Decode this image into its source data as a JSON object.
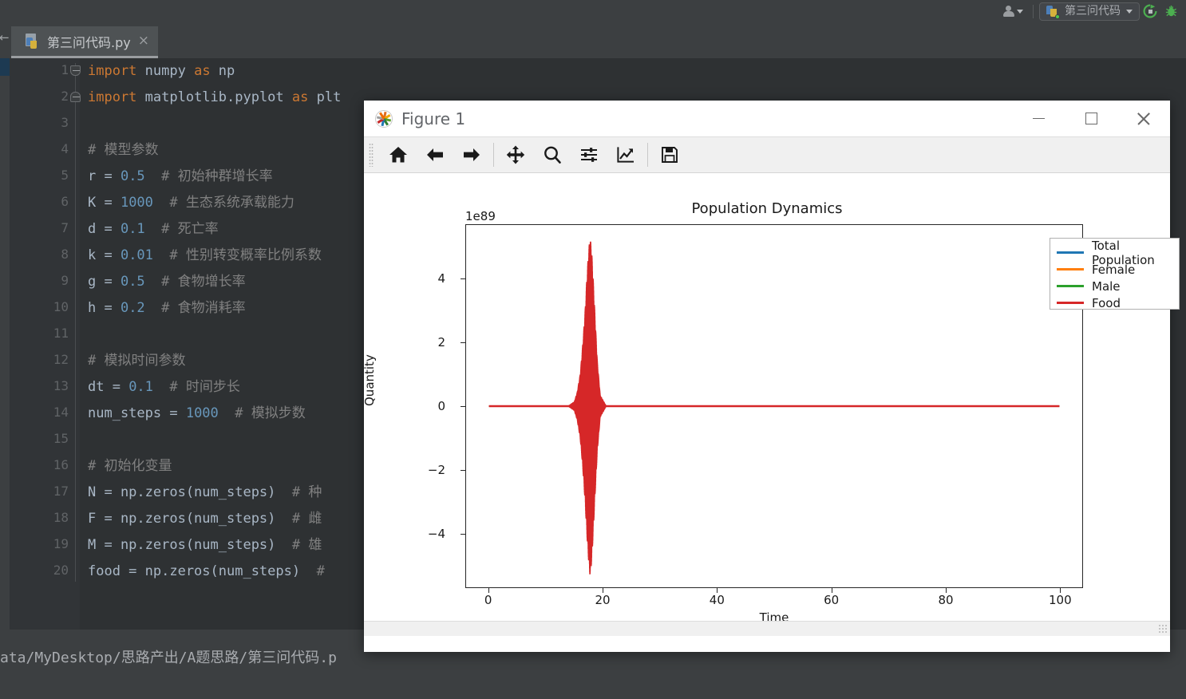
{
  "ide": {
    "toolbar": {
      "account_icon": "user-avatar-icon",
      "account_caret": "chevron-down-icon",
      "run_config_label": "第三问代码",
      "run_config_caret": "chevron-down-icon",
      "rerun_icon": "rerun-icon",
      "debug_icon": "debug-bug-icon"
    },
    "tab": {
      "filename": "第三问代码.py",
      "close_glyph": "×",
      "file_icon": "python-file-icon"
    },
    "statusbar": {
      "path": "ata/MyDesktop/思路产出/A题思路/第三问代码.p"
    },
    "editor": {
      "line_numbers": [
        "1",
        "2",
        "3",
        "4",
        "5",
        "6",
        "7",
        "8",
        "9",
        "10",
        "11",
        "12",
        "13",
        "14",
        "15",
        "16",
        "17",
        "18",
        "19",
        "20"
      ],
      "lines": [
        {
          "n": 1,
          "tokens": [
            {
              "t": "import ",
              "c": "kw"
            },
            {
              "t": "numpy ",
              "c": "id"
            },
            {
              "t": "as ",
              "c": "kw"
            },
            {
              "t": "np",
              "c": "id"
            }
          ]
        },
        {
          "n": 2,
          "tokens": [
            {
              "t": "import ",
              "c": "kw"
            },
            {
              "t": "matplotlib.pyplot ",
              "c": "id"
            },
            {
              "t": "as ",
              "c": "kw"
            },
            {
              "t": "plt",
              "c": "id"
            }
          ]
        },
        {
          "n": 3,
          "tokens": []
        },
        {
          "n": 4,
          "tokens": [
            {
              "t": "# 模型参数",
              "c": "cmt"
            }
          ]
        },
        {
          "n": 5,
          "tokens": [
            {
              "t": "r = ",
              "c": "id"
            },
            {
              "t": "0.5",
              "c": "num"
            },
            {
              "t": "  # 初始种群增长率",
              "c": "cmt"
            }
          ]
        },
        {
          "n": 6,
          "tokens": [
            {
              "t": "K = ",
              "c": "id"
            },
            {
              "t": "1000",
              "c": "num"
            },
            {
              "t": "  # 生态系统承载能力",
              "c": "cmt"
            }
          ]
        },
        {
          "n": 7,
          "tokens": [
            {
              "t": "d = ",
              "c": "id"
            },
            {
              "t": "0.1",
              "c": "num"
            },
            {
              "t": "  # 死亡率",
              "c": "cmt"
            }
          ]
        },
        {
          "n": 8,
          "tokens": [
            {
              "t": "k = ",
              "c": "id"
            },
            {
              "t": "0.01",
              "c": "num"
            },
            {
              "t": "  # 性别转变概率比例系数",
              "c": "cmt"
            }
          ]
        },
        {
          "n": 9,
          "tokens": [
            {
              "t": "g = ",
              "c": "id"
            },
            {
              "t": "0.5",
              "c": "num"
            },
            {
              "t": "  # 食物增长率",
              "c": "cmt"
            }
          ]
        },
        {
          "n": 10,
          "tokens": [
            {
              "t": "h = ",
              "c": "id"
            },
            {
              "t": "0.2",
              "c": "num"
            },
            {
              "t": "  # 食物消耗率",
              "c": "cmt"
            }
          ]
        },
        {
          "n": 11,
          "tokens": []
        },
        {
          "n": 12,
          "tokens": [
            {
              "t": "# 模拟时间参数",
              "c": "cmt"
            }
          ]
        },
        {
          "n": 13,
          "tokens": [
            {
              "t": "dt = ",
              "c": "id"
            },
            {
              "t": "0.1",
              "c": "num"
            },
            {
              "t": "  # 时间步长",
              "c": "cmt"
            }
          ]
        },
        {
          "n": 14,
          "tokens": [
            {
              "t": "num_steps = ",
              "c": "id"
            },
            {
              "t": "1000",
              "c": "num"
            },
            {
              "t": "  # 模拟步数",
              "c": "cmt"
            }
          ]
        },
        {
          "n": 15,
          "tokens": []
        },
        {
          "n": 16,
          "tokens": [
            {
              "t": "# 初始化变量",
              "c": "cmt"
            }
          ]
        },
        {
          "n": 17,
          "tokens": [
            {
              "t": "N = np.zeros(num_steps)",
              "c": "id"
            },
            {
              "t": "  # 种",
              "c": "cmt"
            }
          ]
        },
        {
          "n": 18,
          "tokens": [
            {
              "t": "F = np.zeros(num_steps)",
              "c": "id"
            },
            {
              "t": "  # 雌",
              "c": "cmt"
            }
          ]
        },
        {
          "n": 19,
          "tokens": [
            {
              "t": "M = np.zeros(num_steps)",
              "c": "id"
            },
            {
              "t": "  # 雄",
              "c": "cmt"
            }
          ]
        },
        {
          "n": 20,
          "tokens": [
            {
              "t": "food = np.zeros(num_steps)",
              "c": "id"
            },
            {
              "t": "  #",
              "c": "cmt"
            }
          ]
        }
      ]
    }
  },
  "figure_window": {
    "title": "Figure 1",
    "logo_icon": "matplotlib-logo-icon",
    "window_controls": {
      "minimize": "minimize-icon",
      "maximize": "maximize-icon",
      "close": "close-icon"
    },
    "toolbar_tools": [
      {
        "name": "home-icon",
        "tooltip": "Home"
      },
      {
        "name": "back-arrow-icon",
        "tooltip": "Back"
      },
      {
        "name": "forward-arrow-icon",
        "tooltip": "Forward"
      },
      {
        "name": "pan-move-icon",
        "tooltip": "Pan"
      },
      {
        "name": "zoom-magnifier-icon",
        "tooltip": "Zoom"
      },
      {
        "name": "configure-subplots-icon",
        "tooltip": "Configure subplots"
      },
      {
        "name": "edit-axis-curve-icon",
        "tooltip": "Edit axis"
      },
      {
        "name": "save-floppy-icon",
        "tooltip": "Save"
      }
    ]
  },
  "chart_data": {
    "type": "line",
    "title": "Population Dynamics",
    "xlabel": "Time",
    "ylabel": "Quantity",
    "y_exponent_label": "1e89",
    "xlim": [
      -4,
      104
    ],
    "ylim": [
      -5.7,
      5.7
    ],
    "xticks": [
      0,
      20,
      40,
      60,
      80,
      100
    ],
    "yticks": [
      -4,
      -2,
      0,
      2,
      4
    ],
    "grid": false,
    "legend_position": "upper right",
    "series": [
      {
        "name": "Total Population",
        "color": "#1f77b4",
        "x": [
          0,
          100
        ],
        "values": [
          0,
          0
        ]
      },
      {
        "name": "Female",
        "color": "#ff7f0e",
        "x": [
          0,
          100
        ],
        "values": [
          0,
          0
        ]
      },
      {
        "name": "Male",
        "color": "#2ca02c",
        "x": [
          0,
          100
        ],
        "values": [
          0,
          0
        ]
      },
      {
        "name": "Food",
        "color": "#d62728",
        "note": "Flat at 0 everywhere except a divergent oscillation burst near t=15-19; envelope grows then collapses, peak magnitude ~5.3e89",
        "x": [
          0,
          14.0,
          15.0,
          15.5,
          16.0,
          16.3,
          16.6,
          16.9,
          17.1,
          17.3,
          17.5,
          17.7,
          17.9,
          18.1,
          18.3,
          18.6,
          19.0,
          19.5,
          20.5,
          100
        ],
        "envelope": [
          0,
          0.02,
          0.15,
          0.45,
          1.0,
          1.6,
          2.3,
          3.1,
          3.8,
          4.4,
          4.9,
          5.3,
          5.1,
          4.6,
          3.9,
          2.8,
          1.4,
          0.35,
          0.02,
          0
        ]
      }
    ]
  }
}
